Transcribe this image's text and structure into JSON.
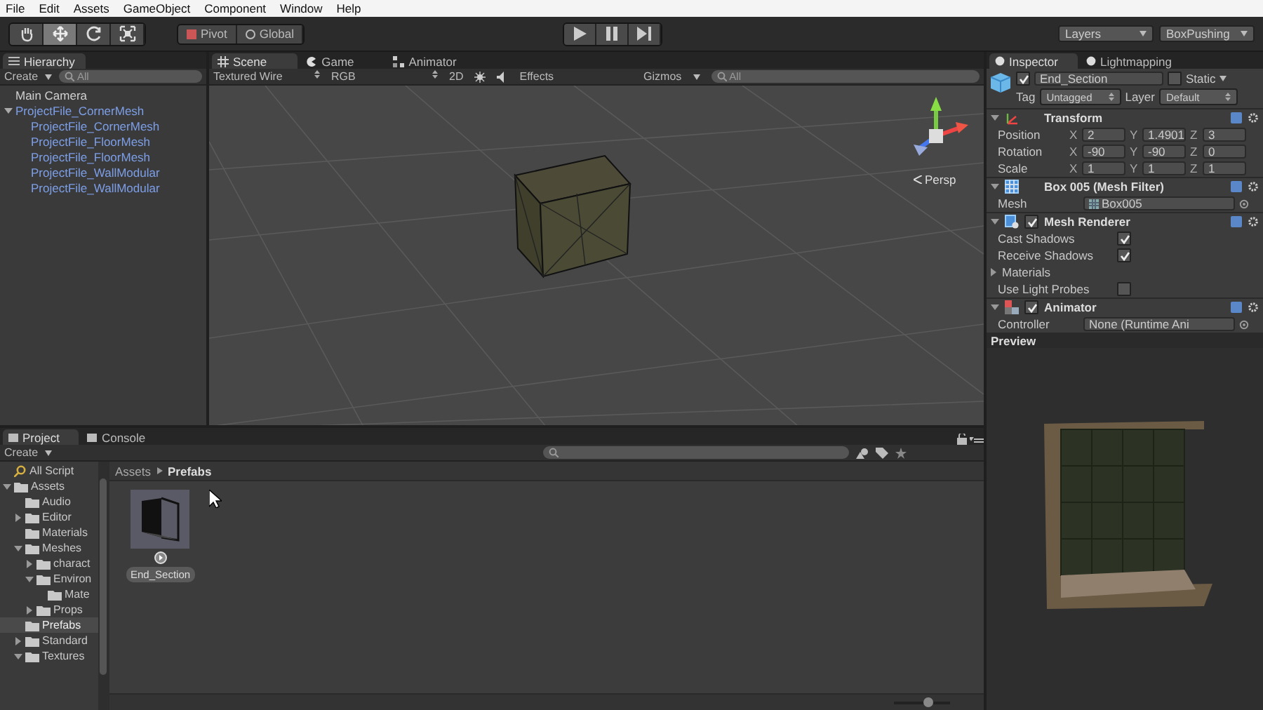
{
  "menu": [
    "File",
    "Edit",
    "Assets",
    "GameObject",
    "Component",
    "Window",
    "Help"
  ],
  "toolbar": {
    "tools": [
      {
        "kind": "hand",
        "selected": false
      },
      {
        "kind": "move",
        "selected": true
      },
      {
        "kind": "rotate",
        "selected": false
      },
      {
        "kind": "scale",
        "selected": false
      }
    ],
    "pivot": "Pivot",
    "global": "Global",
    "playback": [
      {
        "kind": "play",
        "on": false
      },
      {
        "kind": "pause",
        "on": false
      },
      {
        "kind": "step",
        "on": false
      }
    ],
    "layers": "Layers",
    "layout": "BoxPushing"
  },
  "hierarchy": {
    "tab": "Hierarchy",
    "create": "Create",
    "search": {
      "placeholder": "All"
    },
    "items": [
      {
        "label": "Main Camera",
        "prefab": false,
        "selected": false
      },
      {
        "label": "ProjectFile_CornerMesh",
        "prefab": true,
        "selected": false,
        "expanded": true,
        "children": [
          {
            "label": "ProjectFile_CornerMesh",
            "prefab": true,
            "selected": false
          },
          {
            "label": "ProjectFile_FloorMesh",
            "prefab": true,
            "selected": false
          },
          {
            "label": "ProjectFile_FloorMesh",
            "prefab": true,
            "selected": false
          },
          {
            "label": "ProjectFile_WallModular",
            "prefab": true,
            "selected": false
          },
          {
            "label": "ProjectFile_WallModular",
            "prefab": true,
            "selected": false
          }
        ]
      }
    ]
  },
  "scene": {
    "tabs": [
      {
        "label": "Scene",
        "kind": "scene",
        "selected": true
      },
      {
        "label": "Game",
        "kind": "game",
        "selected": false
      },
      {
        "label": "Animator",
        "kind": "animator",
        "selected": false
      }
    ],
    "shading": "Textured Wire",
    "render_mode": "RGB",
    "mode_2d": "2D",
    "effects": "Effects",
    "gizmos": "Gizmos",
    "search": {
      "placeholder": "All"
    },
    "projection": "Persp"
  },
  "inspector": {
    "tabs": [
      {
        "label": "Inspector",
        "selected": true
      },
      {
        "label": "Lightmapping",
        "selected": false
      }
    ],
    "object": {
      "name": "End_Section",
      "active": true,
      "static_label": "Static",
      "static": false,
      "tag_label": "Tag",
      "tag": "Untagged",
      "layer_label": "Layer",
      "layer": "Default"
    },
    "components": [
      {
        "kind": "transform",
        "title": "Transform",
        "rows": [
          {
            "label": "Position",
            "values": [
              {
                "axis": "X",
                "value": "2"
              },
              {
                "axis": "Y",
                "value": "1.4901"
              },
              {
                "axis": "Z",
                "value": "3"
              }
            ]
          },
          {
            "label": "Rotation",
            "values": [
              {
                "axis": "X",
                "value": "-90"
              },
              {
                "axis": "Y",
                "value": "-90"
              },
              {
                "axis": "Z",
                "value": "0"
              }
            ]
          },
          {
            "label": "Scale",
            "values": [
              {
                "axis": "X",
                "value": "1"
              },
              {
                "axis": "Y",
                "value": "1"
              },
              {
                "axis": "Z",
                "value": "1"
              }
            ]
          }
        ]
      },
      {
        "kind": "mesh_filter",
        "title": "Box 005 (Mesh Filter)",
        "fields": [
          {
            "label": "Mesh",
            "value": "Box005"
          }
        ]
      },
      {
        "kind": "mesh_renderer",
        "title": "Mesh Renderer",
        "enabled": true,
        "rows": [
          {
            "kind": "checkbox",
            "label": "Cast Shadows",
            "checked": true
          },
          {
            "kind": "checkbox",
            "label": "Receive Shadows",
            "checked": true
          },
          {
            "kind": "foldout",
            "label": "Materials",
            "expanded": false
          },
          {
            "kind": "checkbox",
            "label": "Use Light Probes",
            "checked": false
          }
        ]
      },
      {
        "kind": "animator",
        "title": "Animator",
        "enabled": true,
        "fields": [
          {
            "label": "Controller",
            "value": "None (Runtime Ani"
          }
        ]
      }
    ]
  },
  "preview": {
    "title": "Preview"
  },
  "project": {
    "tabs": [
      {
        "label": "Project",
        "selected": true
      },
      {
        "label": "Console",
        "selected": false
      }
    ],
    "create": "Create",
    "tree": [
      {
        "label": "All Script",
        "kind": "search",
        "selected": false
      },
      {
        "label": "Assets",
        "kind": "folder",
        "selected": false,
        "expanded": true,
        "children": [
          {
            "label": "Audio",
            "kind": "folder",
            "selected": false
          },
          {
            "label": "Editor",
            "kind": "folder",
            "selected": false,
            "expanded": false
          },
          {
            "label": "Materials",
            "kind": "folder",
            "selected": false
          },
          {
            "label": "Meshes",
            "kind": "folder",
            "selected": false,
            "expanded": true,
            "children": [
              {
                "label": "charact",
                "kind": "folder",
                "selected": false,
                "expanded": false
              },
              {
                "label": "Environ",
                "kind": "folder",
                "selected": false,
                "expanded": true,
                "children": [
                  {
                    "label": "Mate",
                    "kind": "folder",
                    "selected": false
                  }
                ]
              },
              {
                "label": "Props",
                "kind": "folder",
                "selected": false,
                "expanded": false
              }
            ]
          },
          {
            "label": "Prefabs",
            "kind": "folder",
            "selected": true
          },
          {
            "label": "Standard",
            "kind": "folder",
            "selected": false,
            "expanded": false
          },
          {
            "label": "Textures",
            "kind": "folder",
            "selected": false,
            "expanded": true
          }
        ]
      }
    ],
    "breadcrumb": [
      "Assets",
      "Prefabs"
    ],
    "assets": [
      {
        "name": "End_Section",
        "selected": true
      }
    ],
    "zoom": {
      "level": 0.6
    }
  }
}
